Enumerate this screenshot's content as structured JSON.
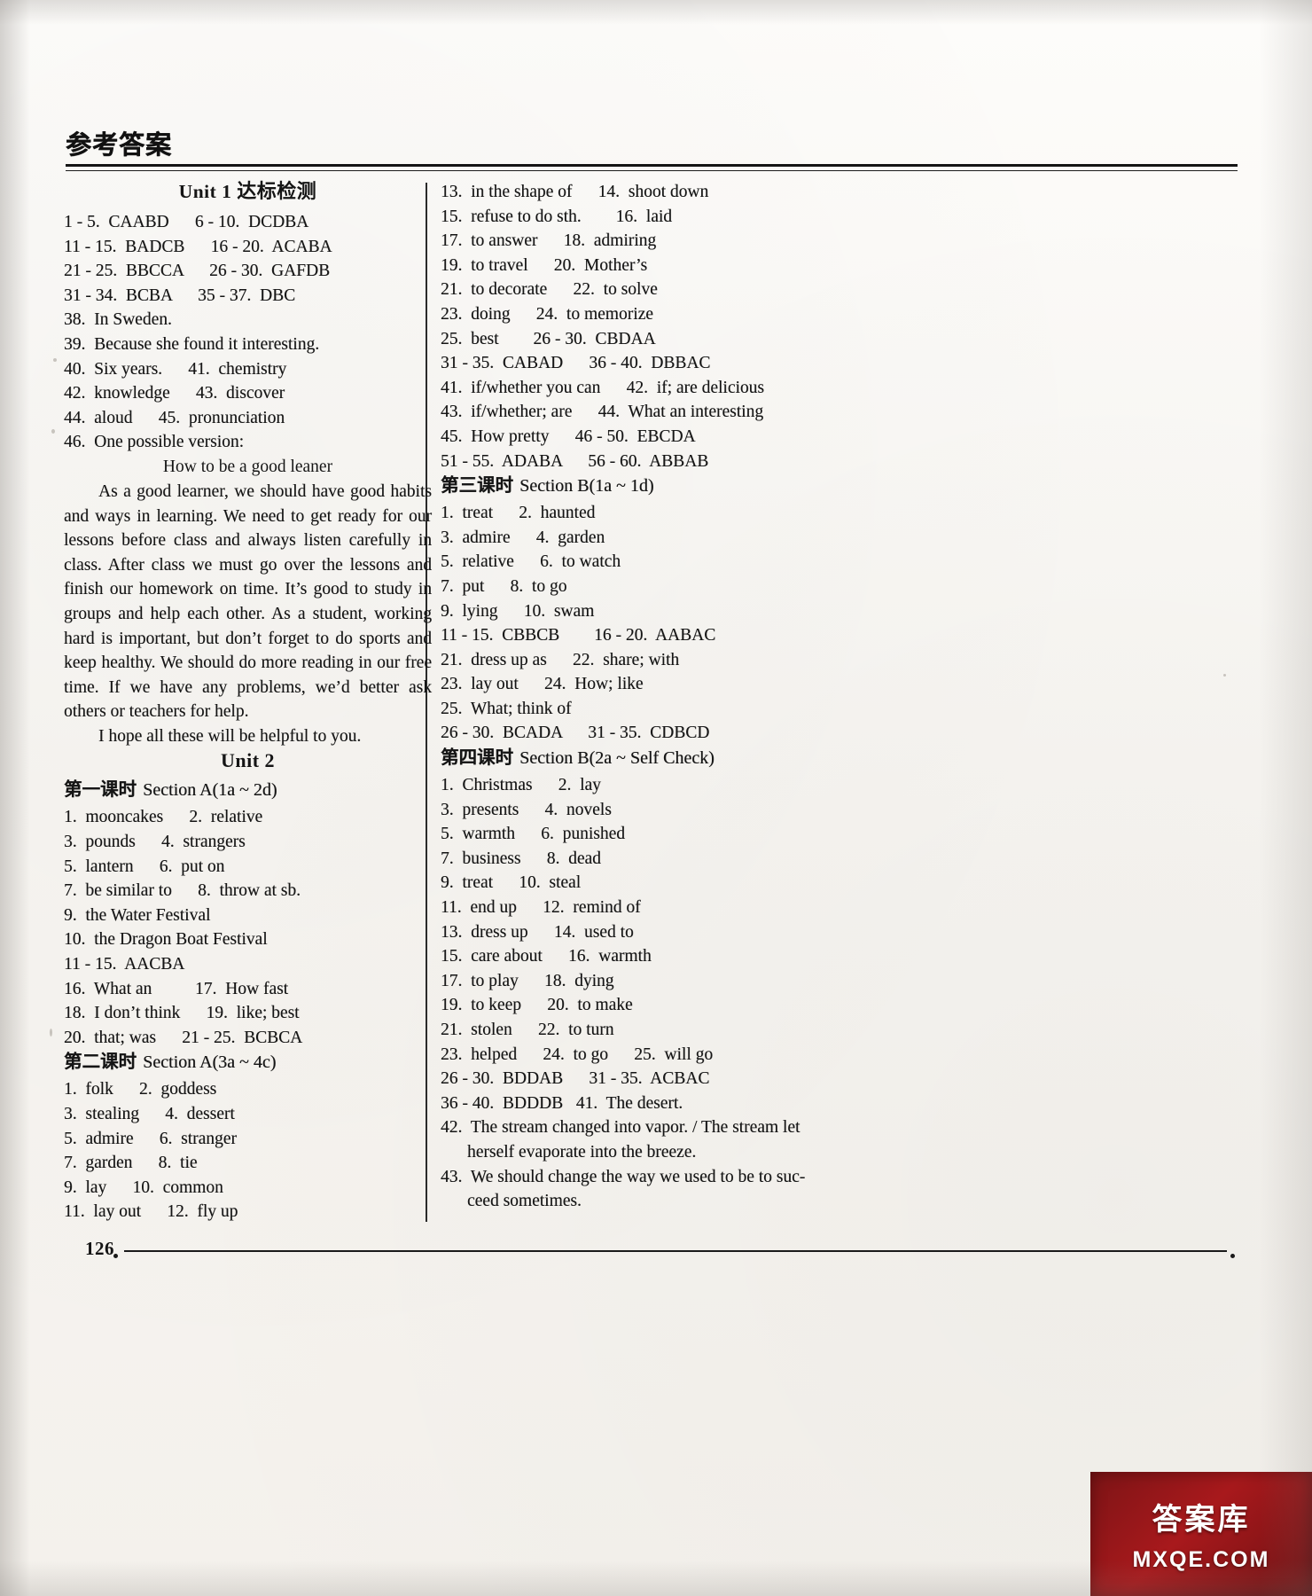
{
  "header": {
    "title_cn": "参考答案"
  },
  "footer": {
    "page_number": "126"
  },
  "watermark": {
    "seal_text": "答案库",
    "site_text": "MXQE.COM"
  },
  "left_column": {
    "unit1_heading": {
      "unit": "Unit 1 ",
      "cn": "达标检测"
    },
    "unit1_answers": [
      "1 - 5.  CAABD      6 - 10.  DCDBA",
      "11 - 15.  BADCB      16 - 20.  ACABA",
      "21 - 25.  BBCCA      26 - 30.  GAFDB",
      "31 - 34.  BCBA      35 - 37.  DBC",
      "38.  In Sweden.",
      "39.  Because she found it interesting.",
      "40.  Six years.      41.  chemistry",
      "42.  knowledge      43.  discover",
      "44.  aloud      45.  pronunciation",
      "46.  One possible version:"
    ],
    "essay": {
      "title": "How to be a good leaner",
      "body1": "As a good learner, we should have good habits and ways in learning. We need to get ready for our lessons before class and always listen carefully in class. After class we must go over the lessons and finish our homework on time. It’s good to study in groups and help each other. As a student, working hard is important, but don’t forget to do sports and keep healthy. We should do more reading in our free time. If we have any problems, we’d better ask others or teachers for help.",
      "body2": "I hope all these will be helpful to you."
    },
    "unit2_heading": "Unit 2",
    "lesson1": {
      "cn": "第一课时 ",
      "en": "Section A(1a ~ 2d)",
      "answers": [
        "1.  mooncakes      2.  relative",
        "3.  pounds      4.  strangers",
        "5.  lantern      6.  put on",
        "7.  be similar to      8.  throw at sb.",
        "9.  the Water Festival",
        "10.  the Dragon Boat Festival",
        "11 - 15.  AACBA",
        "16.  What an          17.  How fast",
        "18.  I don’t think      19.  like; best",
        "20.  that; was      21 - 25.  BCBCA"
      ]
    },
    "lesson2": {
      "cn": "第二课时 ",
      "en": "Section A(3a ~ 4c)",
      "answers": [
        "1.  folk      2.  goddess",
        "3.  stealing      4.  dessert",
        "5.  admire      6.  stranger",
        "7.  garden      8.  tie",
        "9.  lay      10.  common",
        "11.  lay out      12.  fly up"
      ]
    }
  },
  "right_column": {
    "continued_answers": [
      "13.  in the shape of      14.  shoot down",
      "15.  refuse to do sth.        16.  laid",
      "17.  to answer      18.  admiring",
      "19.  to travel      20.  Mother’s",
      "21.  to decorate      22.  to solve",
      "23.  doing      24.  to memorize",
      "25.  best        26 - 30.  CBDAA",
      "31 - 35.  CABAD      36 - 40.  DBBAC",
      "41.  if/whether you can      42.  if; are delicious",
      "43.  if/whether; are      44.  What an interesting",
      "45.  How pretty      46 - 50.  EBCDA",
      "51 - 55.  ADABA      56 - 60.  ABBAB"
    ],
    "lesson3": {
      "cn": "第三课时 ",
      "en": "Section B(1a ~ 1d)",
      "answers": [
        "1.  treat      2.  haunted",
        "3.  admire      4.  garden",
        "5.  relative      6.  to watch",
        "7.  put      8.  to go",
        "9.  lying      10.  swam",
        "11 - 15.  CBBCB        16 - 20.  AABAC",
        "21.  dress up as      22.  share; with",
        "23.  lay out      24.  How; like",
        "25.  What; think of",
        "26 - 30.  BCADA      31 - 35.  CDBCD"
      ]
    },
    "lesson4": {
      "cn": "第四课时 ",
      "en": "Section B(2a ~ Self Check)",
      "answers": [
        "1.  Christmas      2.  lay",
        "3.  presents      4.  novels",
        "5.  warmth      6.  punished",
        "7.  business      8.  dead",
        "9.  treat      10.  steal",
        "11.  end up      12.  remind of",
        "13.  dress up      14.  used to",
        "15.  care about      16.  warmth",
        "17.  to play      18.  dying",
        "19.  to keep      20.  to make",
        "21.  stolen      22.  to turn",
        "23.  helped      24.  to go      25.  will go",
        "26 - 30.  BDDAB      31 - 35.  ACBAC",
        "36 - 40.  BDDDB   41.  The desert."
      ],
      "long_answers": [
        {
          "line1": "42.  The stream changed into vapor. / The stream let",
          "line2": "herself evaporate into the breeze."
        },
        {
          "line1": "43.  We should change the way we used to be to suc-",
          "line2": "ceed sometimes."
        }
      ]
    }
  }
}
